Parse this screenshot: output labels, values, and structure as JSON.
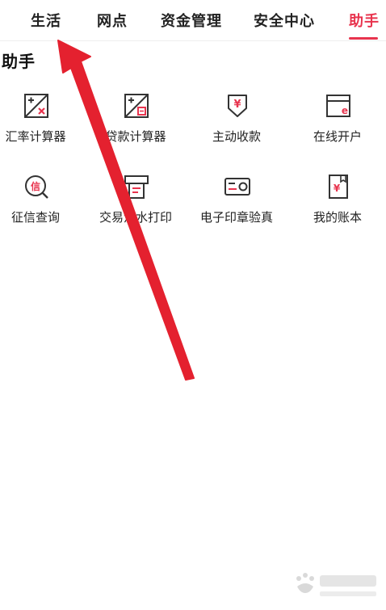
{
  "tabs": [
    {
      "label": "生活",
      "active": false
    },
    {
      "label": "网点",
      "active": false
    },
    {
      "label": "资金管理",
      "active": false
    },
    {
      "label": "安全中心",
      "active": false
    },
    {
      "label": "助手",
      "active": true
    }
  ],
  "section": {
    "title": "助手"
  },
  "tools": [
    {
      "label": "汇率计算器",
      "icon": "exchange-rate-calculator-icon"
    },
    {
      "label": "贷款计算器",
      "icon": "loan-calculator-icon"
    },
    {
      "label": "主动收款",
      "icon": "yuan-receive-icon"
    },
    {
      "label": "在线开户",
      "icon": "online-account-icon"
    },
    {
      "label": "征信查询",
      "icon": "credit-search-icon"
    },
    {
      "label": "交易流水打印",
      "icon": "statement-print-icon"
    },
    {
      "label": "电子印章验真",
      "icon": "e-seal-verify-icon"
    },
    {
      "label": "我的账本",
      "icon": "ledger-book-icon"
    }
  ],
  "icon_glyphs": {
    "yuan": "¥",
    "credit": "信",
    "online": "e"
  },
  "colors": {
    "accent": "#e8344e",
    "arrow": "#e4212f",
    "icon_stroke": "#333333"
  }
}
